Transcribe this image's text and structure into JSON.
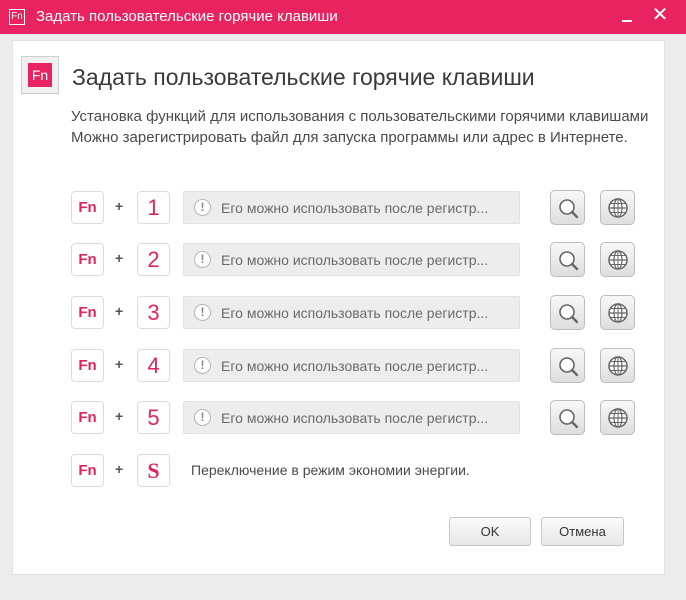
{
  "window": {
    "title": "Задать пользовательские горячие клавиши",
    "icon_label": "Fn"
  },
  "header": {
    "icon_label": "Fn",
    "title": "Задать пользовательские горячие клавиши"
  },
  "description": {
    "line1": "Установка функций для использования с пользовательскими горячими клавишами",
    "line2": "Можно зарегистрировать файл для запуска программы или адрес в Интернете."
  },
  "hotkeys": [
    {
      "fn": "Fn",
      "plus": "+",
      "key": "1",
      "status": "Его можно использовать после регистр..."
    },
    {
      "fn": "Fn",
      "plus": "+",
      "key": "2",
      "status": "Его можно использовать после регистр..."
    },
    {
      "fn": "Fn",
      "plus": "+",
      "key": "3",
      "status": "Его можно использовать после регистр..."
    },
    {
      "fn": "Fn",
      "plus": "+",
      "key": "4",
      "status": "Его можно использовать после регистр..."
    },
    {
      "fn": "Fn",
      "plus": "+",
      "key": "5",
      "status": "Его можно использовать после регистр..."
    }
  ],
  "power_row": {
    "fn": "Fn",
    "plus": "+",
    "key": "S",
    "text": "Переключение в режим экономии энергии."
  },
  "buttons": {
    "ok": "OK",
    "cancel": "Отмена"
  },
  "icons": {
    "warning": "!",
    "search": "magnifier-icon",
    "web": "globe-icon"
  },
  "colors": {
    "accent": "#e8235f",
    "key_text": "#e0245e"
  }
}
